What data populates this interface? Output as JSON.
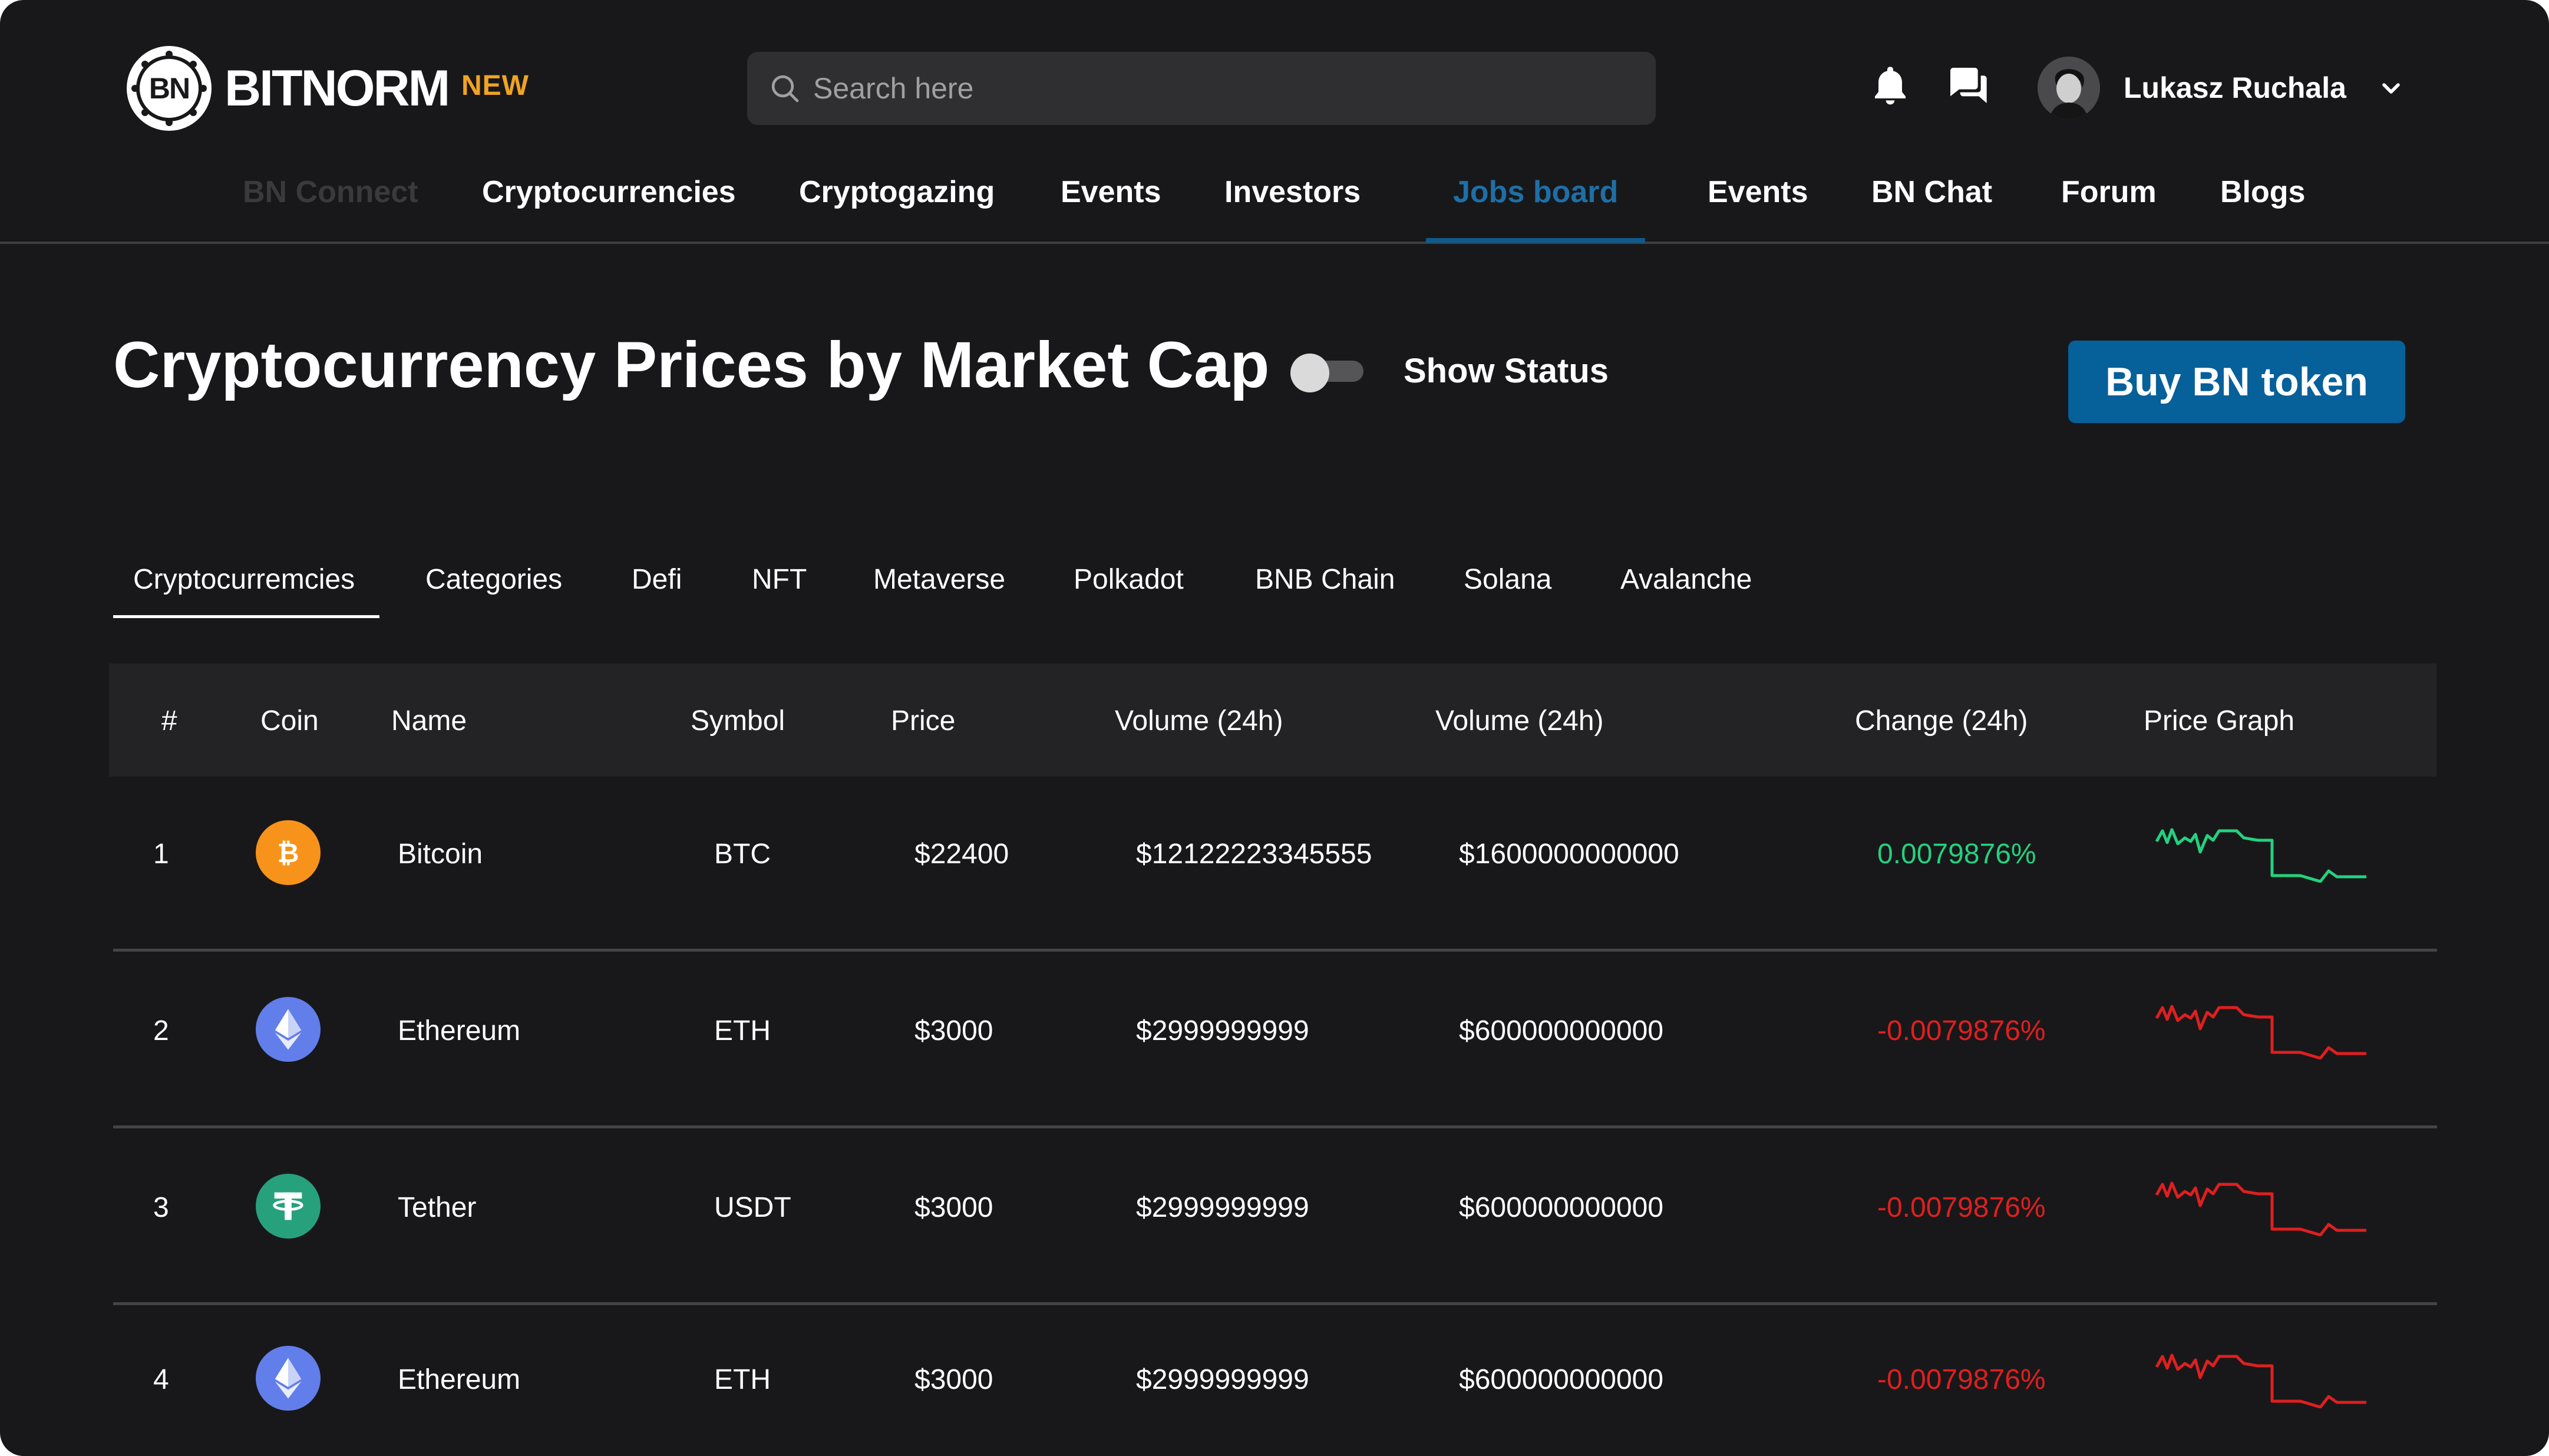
{
  "brand": {
    "logo_mark": "BN",
    "name": "BITNORM",
    "badge": "NEW"
  },
  "search": {
    "placeholder": "Search here"
  },
  "user": {
    "name": "Lukasz Ruchala"
  },
  "nav": {
    "items": [
      "BN Connect",
      "Cryptocurrencies",
      "Cryptogazing",
      "Events",
      "Investors",
      "Jobs board",
      "Events",
      "BN Chat",
      "Forum",
      "Blogs"
    ],
    "active": "Jobs board",
    "disabled": "BN Connect"
  },
  "page": {
    "title": "Cryptocurrency Prices by Market Cap",
    "toggle_label": "Show Status",
    "toggle_on": false,
    "buy_button": "Buy BN token"
  },
  "tabs": {
    "items": [
      "Cryptocurremcies",
      "Categories",
      "Defi",
      "NFT",
      "Metaverse",
      "Polkadot",
      "BNB Chain",
      "Solana",
      "Avalanche"
    ],
    "active": "Cryptocurremcies"
  },
  "table": {
    "headers": [
      "#",
      "Coin",
      "Name",
      "Symbol",
      "Price",
      "Volume (24h)",
      "Volume (24h)",
      "Change (24h)",
      "Price Graph"
    ],
    "rows": [
      {
        "rank": "1",
        "coin_icon": "bitcoin-icon",
        "name": "Bitcoin",
        "symbol": "BTC",
        "price": "$22400",
        "volume": "$12122223345555",
        "volume2": "$1600000000000",
        "change": "0.0079876%",
        "trend": "up"
      },
      {
        "rank": "2",
        "coin_icon": "ethereum-icon",
        "name": "Ethereum",
        "symbol": "ETH",
        "price": "$3000",
        "volume": "$2999999999",
        "volume2": "$600000000000",
        "change": "-0.0079876%",
        "trend": "down"
      },
      {
        "rank": "3",
        "coin_icon": "tether-icon",
        "name": "Tether",
        "symbol": "USDT",
        "price": "$3000",
        "volume": "$2999999999",
        "volume2": "$600000000000",
        "change": "-0.0079876%",
        "trend": "down"
      },
      {
        "rank": "4",
        "coin_icon": "ethereum-icon",
        "name": "Ethereum",
        "symbol": "ETH",
        "price": "$3000",
        "volume": "$2999999999",
        "volume2": "$600000000000",
        "change": "-0.0079876%",
        "trend": "down"
      }
    ]
  },
  "colors": {
    "background": "#18181a",
    "accent": "#06609a",
    "nav_active": "#1e6fa6",
    "new_badge": "#f0a324",
    "positive": "#23d27f",
    "negative": "#e01f1f",
    "bitcoin": "#f7931a",
    "ethereum": "#627eea",
    "tether": "#26a17b"
  }
}
